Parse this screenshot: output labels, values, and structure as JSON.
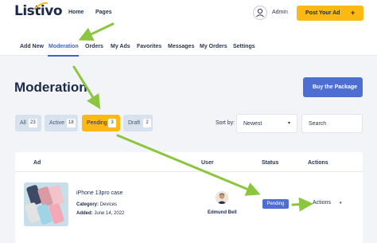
{
  "header": {
    "logo": "Listivo",
    "nav": [
      "Home",
      "Pages"
    ],
    "user_label": "Admin",
    "post_ad_label": "Post Your Ad",
    "post_ad_plus": "+"
  },
  "tabs": [
    "Add New",
    "Moderation",
    "Orders",
    "My Ads",
    "Favorites",
    "Messages",
    "My Orders",
    "Settings"
  ],
  "page": {
    "title": "Moderation",
    "buy_button": "Buy the Package"
  },
  "filters": [
    {
      "label": "All",
      "count": "23"
    },
    {
      "label": "Active",
      "count": "18"
    },
    {
      "label": "Pending",
      "count": "3"
    },
    {
      "label": "Draft",
      "count": "2"
    }
  ],
  "sort": {
    "label": "Sort by:",
    "value": "Newest"
  },
  "search": {
    "placeholder": "Search"
  },
  "table": {
    "headers": {
      "ad": "Ad",
      "user": "User",
      "status": "Status",
      "actions": "Actions"
    },
    "rows": [
      {
        "title": "iPhone 13pro case",
        "category_label": "Category:",
        "category": "Devices",
        "added_label": "Added:",
        "added": "June 14, 2022",
        "user": "Edmund Bell",
        "status": "Pending",
        "actions": "Actions"
      }
    ]
  },
  "colors": {
    "accent_yellow": "#fdb913",
    "primary_blue": "#4d6ed3",
    "arrow_green": "#8cc63f",
    "text_dark": "#1c2a4a"
  },
  "icons": [
    "user-icon",
    "chevron-down-icon",
    "plus-icon"
  ]
}
